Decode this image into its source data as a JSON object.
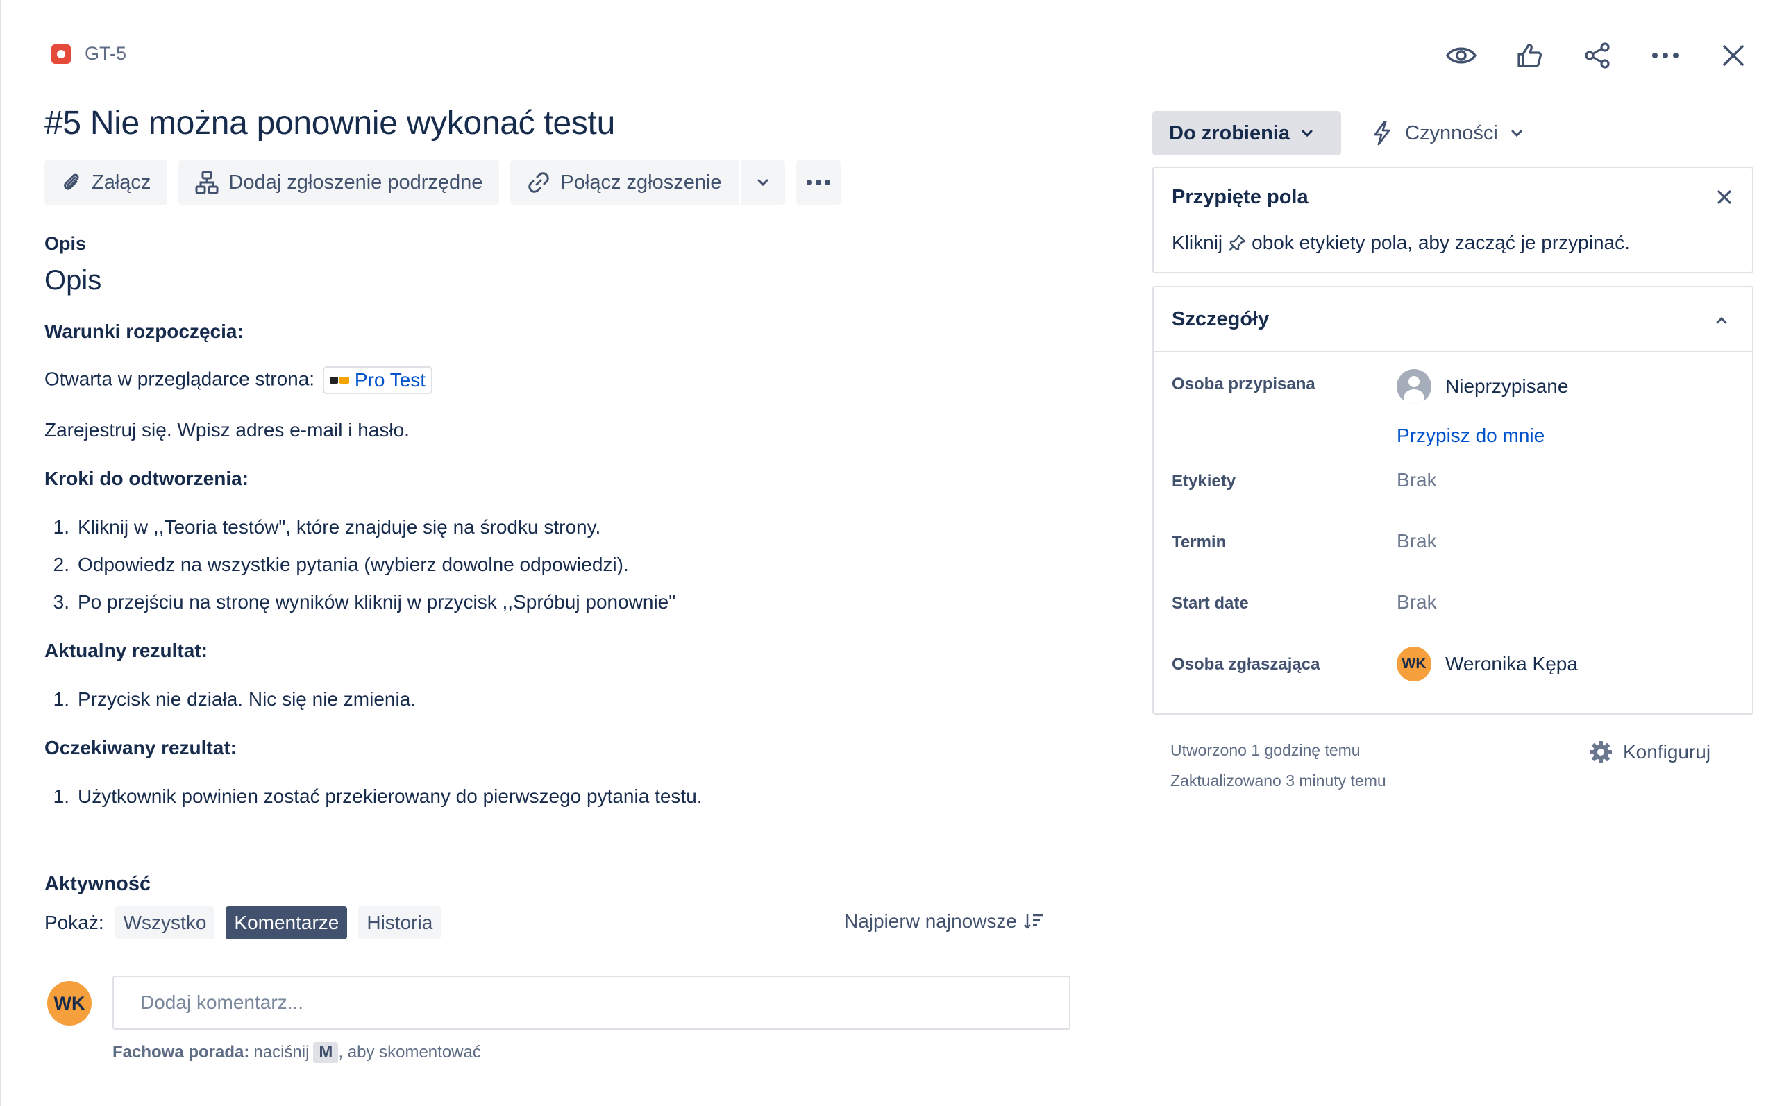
{
  "issue": {
    "key": "GT-5",
    "title": "#5 Nie można ponownie wykonać testu"
  },
  "toolbar": {
    "attach": "Załącz",
    "add_child": "Dodaj zgłoszenie podrzędne",
    "link_issue": "Połącz zgłoszenie"
  },
  "description": {
    "field_label": "Opis",
    "heading": "Opis",
    "preconditions_heading": "Warunki rozpoczęcia:",
    "opened_page_text": "Otwarta w przeglądarce strona:",
    "smart_link": "Pro Test",
    "register_text": "Zarejestruj się. Wpisz adres e-mail i hasło.",
    "steps_heading": "Kroki do odtworzenia:",
    "steps": [
      {
        "num": "1.",
        "text": "Kliknij w ,,Teoria testów\", które znajduje się na środku strony."
      },
      {
        "num": "2.",
        "text": "Odpowiedz na wszystkie pytania (wybierz dowolne odpowiedzi)."
      },
      {
        "num": "3.",
        "text": "Po przejściu na stronę wyników kliknij w przycisk ,,Spróbuj ponownie\""
      }
    ],
    "actual_heading": "Aktualny rezultat:",
    "actual": [
      {
        "num": "1.",
        "text": "Przycisk nie działa. Nic się nie zmienia."
      }
    ],
    "expected_heading": "Oczekiwany rezultat:",
    "expected": [
      {
        "num": "1.",
        "text": "Użytkownik powinien zostać przekierowany do pierwszego pytania testu."
      }
    ]
  },
  "activity": {
    "heading": "Aktywność",
    "show_label": "Pokaż:",
    "filters": [
      "Wszystko",
      "Komentarze",
      "Historia"
    ],
    "selected_filter": "Komentarze",
    "sort_label": "Najpierw najnowsze",
    "comment_placeholder": "Dodaj komentarz...",
    "avatar_initials": "WK",
    "tip_bold": "Fachowa porada:",
    "tip_before_key": "naciśnij",
    "tip_key": "M",
    "tip_after_key": ", aby skomentować"
  },
  "sidebar": {
    "status": "Do zrobienia",
    "actions": "Czynności",
    "pinned": {
      "heading": "Przypięte pola",
      "text_before": "Kliknij",
      "text_after": "obok etykiety pola, aby zacząć je przypinać."
    },
    "details": {
      "heading": "Szczegóły",
      "assignee_label": "Osoba przypisana",
      "assignee_value": "Nieprzypisane",
      "assign_to_me": "Przypisz do mnie",
      "labels_label": "Etykiety",
      "labels_value": "Brak",
      "due_label": "Termin",
      "due_value": "Brak",
      "start_label": "Start date",
      "start_value": "Brak",
      "reporter_label": "Osoba zgłaszająca",
      "reporter_value": "Weronika Kępa",
      "reporter_initials": "WK"
    },
    "created": "Utworzono 1 godzinę temu",
    "updated": "Zaktualizowano 3 minuty temu",
    "configure": "Konfiguruj"
  },
  "colors": {
    "accent": "#0052cc",
    "bug": "#e5493a",
    "avatar": "#f5a03d",
    "selected_chip": "#42526e"
  }
}
